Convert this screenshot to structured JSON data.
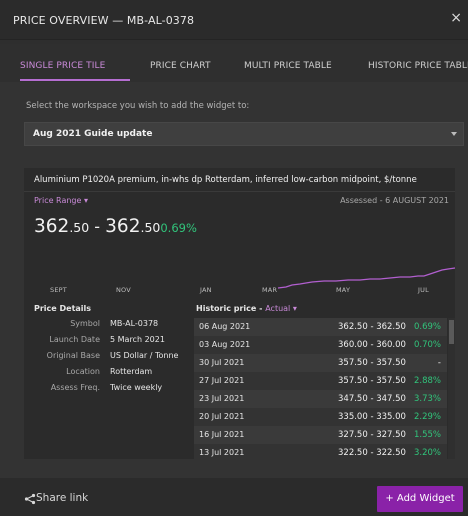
{
  "window": {
    "title": "PRICE OVERVIEW — MB-AL-0378",
    "close_glyph": "×"
  },
  "tabs": [
    {
      "label": "SINGLE PRICE TILE",
      "active": true
    },
    {
      "label": "PRICE CHART",
      "active": false
    },
    {
      "label": "MULTI PRICE TABLE",
      "active": false
    },
    {
      "label": "HISTORIC PRICE TABLE",
      "active": false
    }
  ],
  "workspace": {
    "label": "Select the workspace you wish to add the widget to:",
    "selected": "Aug 2021 Guide update"
  },
  "widget": {
    "product": "Aluminium P1020A premium, in-whs dp Rotterdam, inferred low-carbon midpoint, $/tonne",
    "price_range_label": "Price Range ▾",
    "assessed": "Assessed - 6 AUGUST 2021",
    "price": {
      "low_main": "362",
      "low_dec": ".50",
      "separator": " - ",
      "high_main": "362",
      "high_dec": ".50",
      "change": "0.69%"
    },
    "chart_axis": [
      "SEPT",
      "NOV",
      "JAN",
      "MAR",
      "MAY",
      "JUL"
    ],
    "details": {
      "header": "Price Details",
      "rows": [
        {
          "key": "Symbol",
          "value": "MB-AL-0378"
        },
        {
          "key": "Launch Date",
          "value": "5 March 2021"
        },
        {
          "key": "Original Base",
          "value": "US Dollar / Tonne"
        },
        {
          "key": "Location",
          "value": "Rotterdam"
        },
        {
          "key": "Assess Freq.",
          "value": "Twice weekly"
        }
      ]
    },
    "historic": {
      "header": "Historic price - ",
      "mode": "Actual ▾",
      "rows": [
        {
          "date": "06 Aug 2021",
          "range": "362.50 - 362.50",
          "change": "0.69%"
        },
        {
          "date": "03 Aug 2021",
          "range": "360.00 - 360.00",
          "change": "0.70%"
        },
        {
          "date": "30 Jul 2021",
          "range": "357.50 - 357.50",
          "change": "-"
        },
        {
          "date": "27 Jul 2021",
          "range": "357.50 - 357.50",
          "change": "2.88%"
        },
        {
          "date": "23 Jul 2021",
          "range": "347.50 - 347.50",
          "change": "3.73%"
        },
        {
          "date": "20 Jul 2021",
          "range": "335.00 - 335.00",
          "change": "2.29%"
        },
        {
          "date": "16 Jul 2021",
          "range": "327.50 - 327.50",
          "change": "1.55%"
        },
        {
          "date": "13 Jul 2021",
          "range": "322.50 - 322.50",
          "change": "3.20%"
        }
      ]
    }
  },
  "footer": {
    "share_label": "Share link",
    "add_label": "+ Add Widget"
  },
  "colors": {
    "accent": "#b56ed1",
    "button": "#8a22a8",
    "positive": "#31c47b",
    "chart_line": "#b25fd0"
  }
}
